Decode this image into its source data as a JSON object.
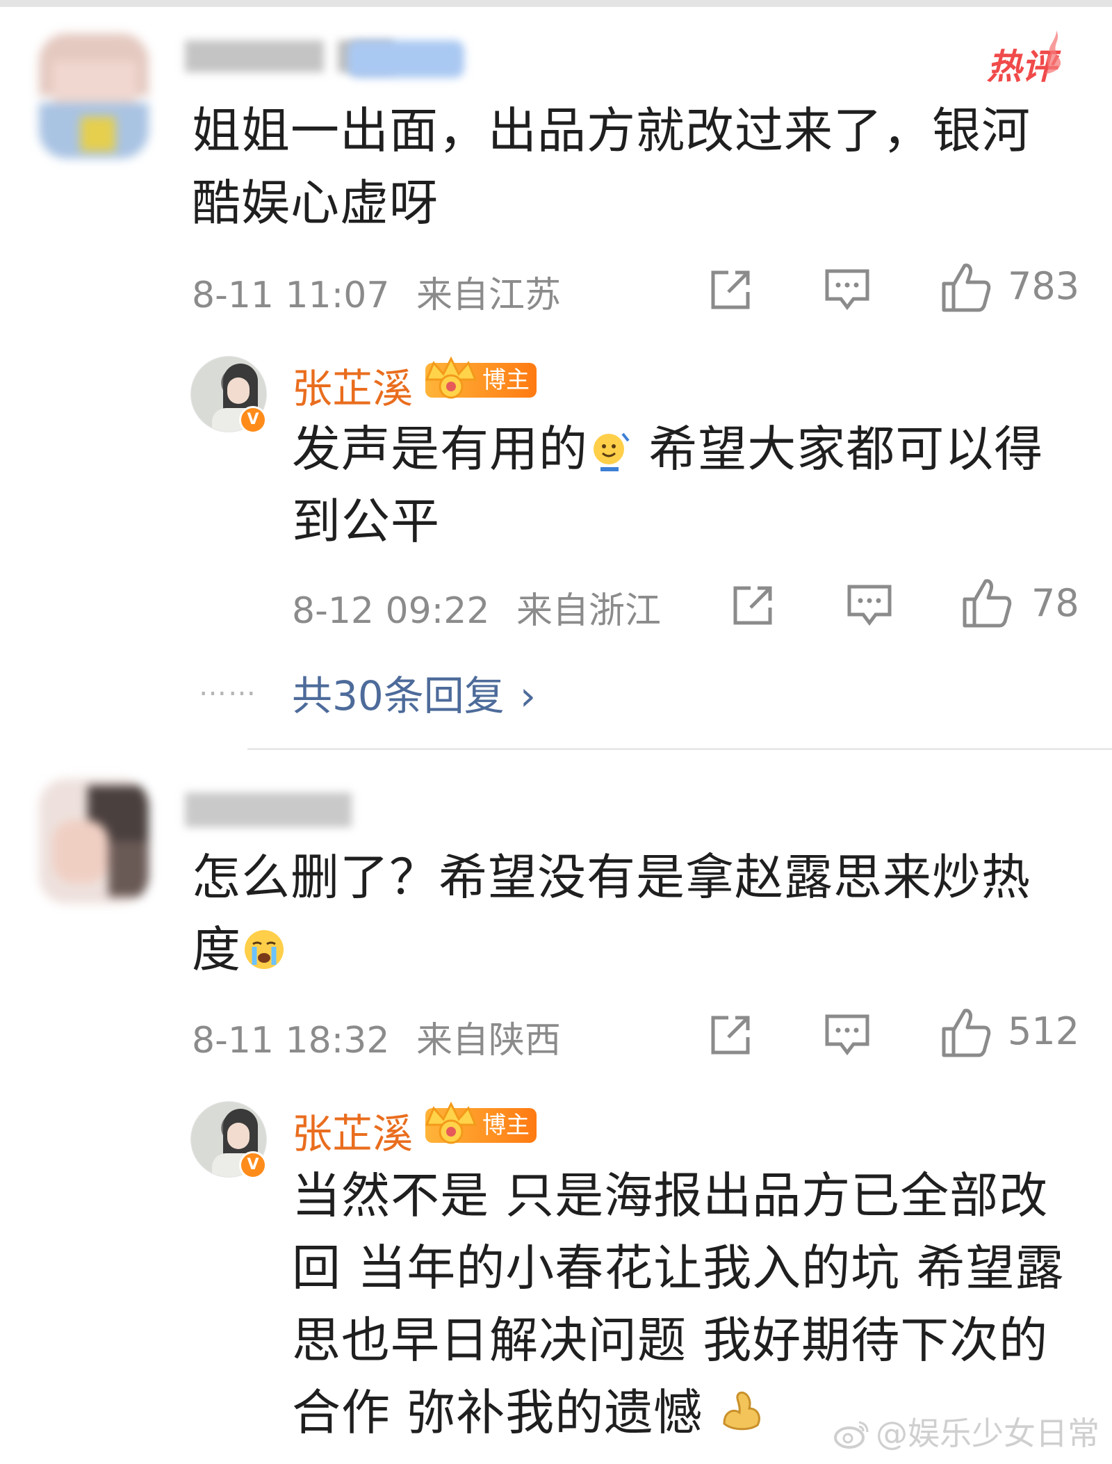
{
  "hot_tag": "热评",
  "comments": [
    {
      "text": "姐姐一出面，出品方就改过来了，银河酷娱心虚呀",
      "time": "8-11 11:07",
      "location": "来自江苏",
      "likes": "783",
      "reply": {
        "name": "张芷溪",
        "badge": "博主",
        "text_before_emoji": "发声是有用的",
        "text_after_emoji": " 希望大家都可以得到公平",
        "time": "8-12 09:22",
        "location": "来自浙江",
        "likes": "78"
      },
      "more_replies": "共30条回复",
      "more_dots": "……"
    },
    {
      "text": "怎么删了？希望没有是拿赵露思来炒热度",
      "time": "8-11 18:32",
      "location": "来自陕西",
      "likes": "512",
      "reply": {
        "name": "张芷溪",
        "badge": "博主",
        "text": "当然不是  只是海报出品方已全部改回 当年的小春花让我入的坑 希望露思也早日解决问题 我好期待下次的合作 弥补我的遗憾"
      }
    }
  ],
  "watermark": "@娱乐少女日常"
}
